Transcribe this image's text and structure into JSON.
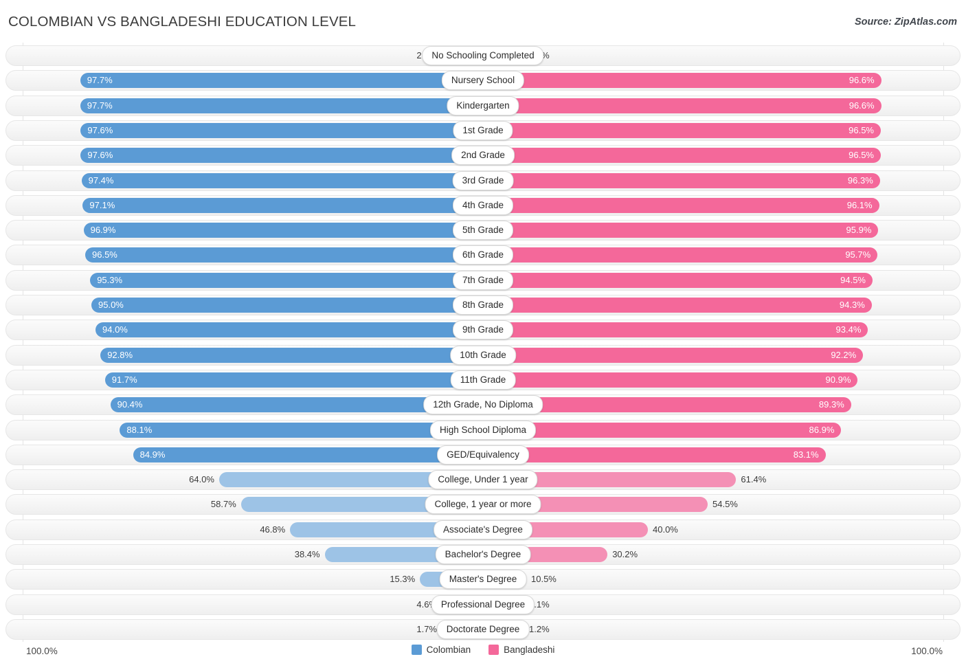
{
  "header": {
    "title": "COLOMBIAN VS BANGLADESHI EDUCATION LEVEL",
    "source": "Source: ZipAtlas.com"
  },
  "colors": {
    "left_strong": "#5b9bd5",
    "left_light": "#9dc3e6",
    "right_strong": "#f4689a",
    "right_light": "#f490b5",
    "track": "#f5f5f5",
    "text": "#3c3c3c"
  },
  "legend": {
    "items": [
      {
        "label": "Colombian",
        "color": "#5b9bd5"
      },
      {
        "label": "Bangladeshi",
        "color": "#f4689a"
      }
    ]
  },
  "axis": {
    "left_max_label": "100.0%",
    "right_max_label": "100.0%"
  },
  "chart_data": {
    "type": "bar",
    "title": "COLOMBIAN VS BANGLADESHI EDUCATION LEVEL",
    "subtitle": "",
    "xlabel": "",
    "ylabel": "",
    "orientation": "horizontal-diverging",
    "xlim": [
      0,
      100
    ],
    "grid": false,
    "legend_position": "bottom-center",
    "categories": [
      "No Schooling Completed",
      "Nursery School",
      "Kindergarten",
      "1st Grade",
      "2nd Grade",
      "3rd Grade",
      "4th Grade",
      "5th Grade",
      "6th Grade",
      "7th Grade",
      "8th Grade",
      "9th Grade",
      "10th Grade",
      "11th Grade",
      "12th Grade, No Diploma",
      "High School Diploma",
      "GED/Equivalency",
      "College, Under 1 year",
      "College, 1 year or more",
      "Associate's Degree",
      "Bachelor's Degree",
      "Master's Degree",
      "Professional Degree",
      "Doctorate Degree"
    ],
    "series": [
      {
        "name": "Colombian",
        "color": "#5b9bd5",
        "side": "left",
        "values": [
          2.3,
          97.7,
          97.7,
          97.6,
          97.6,
          97.4,
          97.1,
          96.9,
          96.5,
          95.3,
          95.0,
          94.0,
          92.8,
          91.7,
          90.4,
          88.1,
          84.9,
          64.0,
          58.7,
          46.8,
          38.4,
          15.3,
          4.6,
          1.7
        ],
        "labels": [
          "2.3%",
          "97.7%",
          "97.7%",
          "97.6%",
          "97.6%",
          "97.4%",
          "97.1%",
          "96.9%",
          "96.5%",
          "95.3%",
          "95.0%",
          "94.0%",
          "92.8%",
          "91.7%",
          "90.4%",
          "88.1%",
          "84.9%",
          "64.0%",
          "58.7%",
          "46.8%",
          "38.4%",
          "15.3%",
          "4.6%",
          "1.7%"
        ]
      },
      {
        "name": "Bangladeshi",
        "color": "#f4689a",
        "side": "right",
        "values": [
          3.5,
          96.6,
          96.6,
          96.5,
          96.5,
          96.3,
          96.1,
          95.9,
          95.7,
          94.5,
          94.3,
          93.4,
          92.2,
          90.9,
          89.3,
          86.9,
          83.1,
          61.4,
          54.5,
          40.0,
          30.2,
          10.5,
          3.1,
          1.2
        ],
        "labels": [
          "3.5%",
          "96.6%",
          "96.6%",
          "96.5%",
          "96.5%",
          "96.3%",
          "96.1%",
          "95.9%",
          "95.7%",
          "94.5%",
          "94.3%",
          "93.4%",
          "92.2%",
          "90.9%",
          "89.3%",
          "86.9%",
          "83.1%",
          "61.4%",
          "54.5%",
          "40.0%",
          "30.2%",
          "10.5%",
          "3.1%",
          "1.2%"
        ]
      }
    ]
  }
}
